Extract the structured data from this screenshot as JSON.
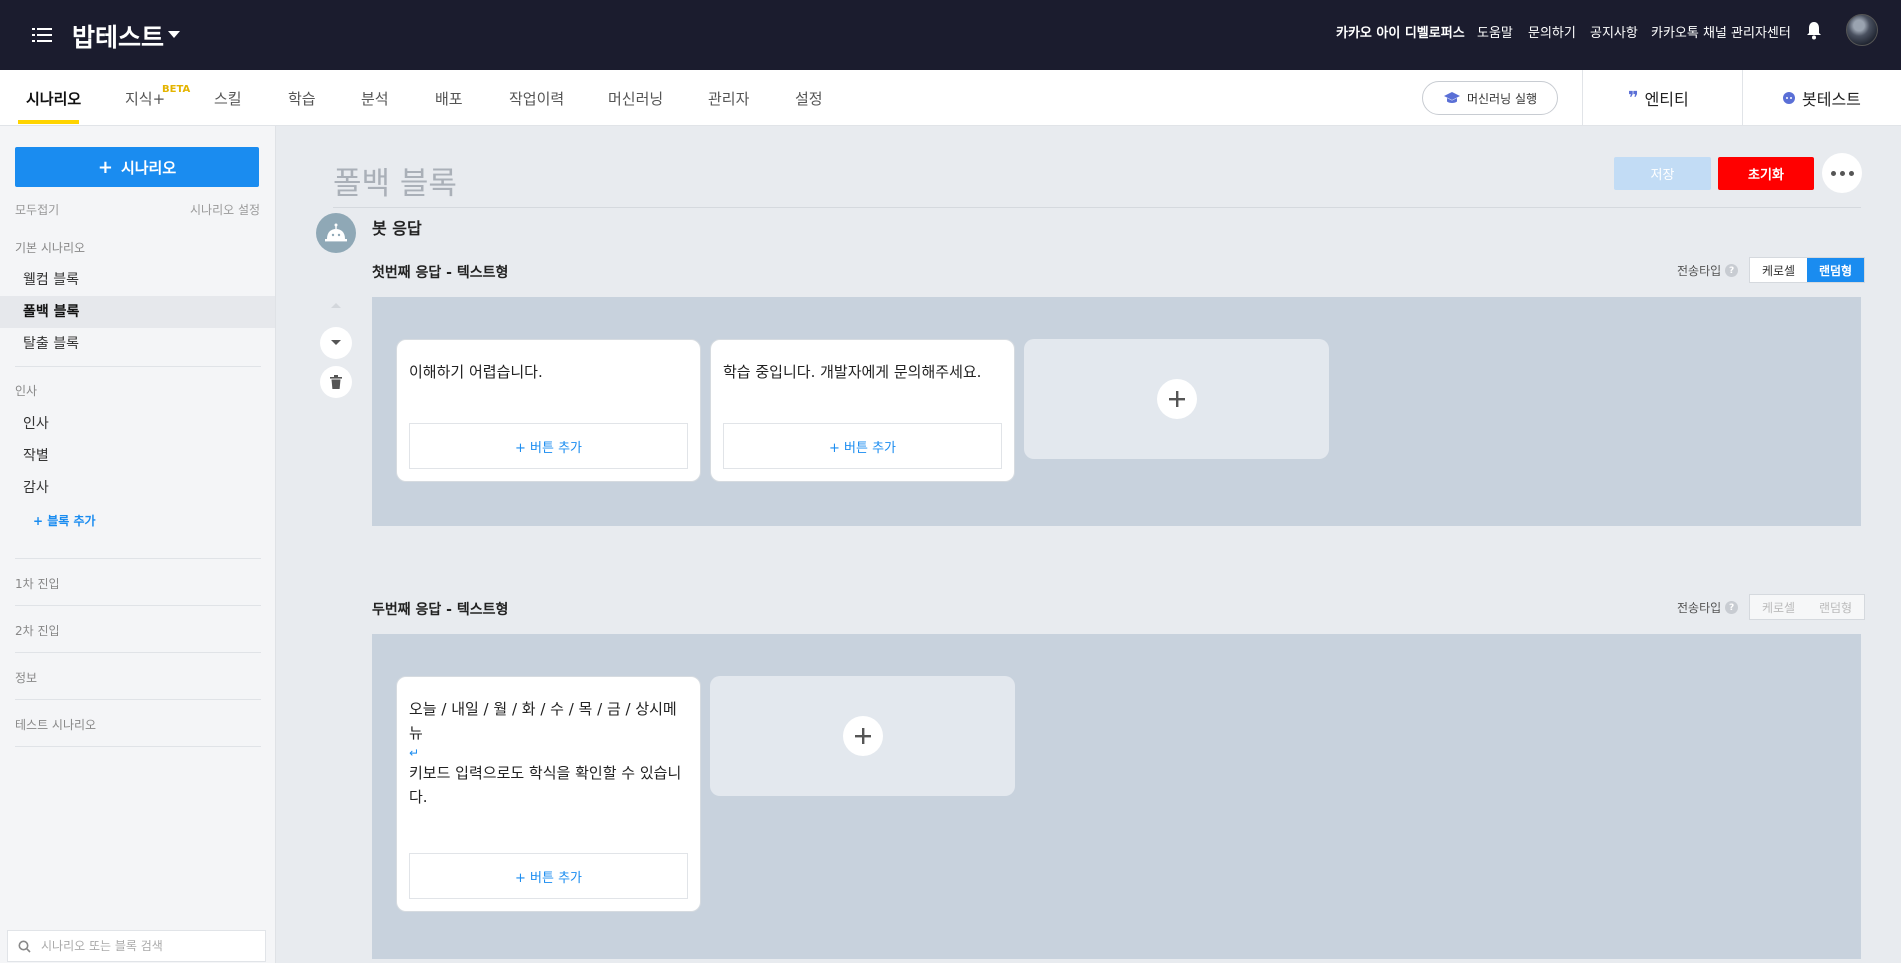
{
  "topbar": {
    "bot_name": "밥테스트",
    "nav": [
      "카카오 아이 디벨로퍼스",
      "도움말",
      "문의하기",
      "공지사항",
      "카카오톡 채널 관리자센터"
    ]
  },
  "tabs": {
    "items": [
      "시나리오",
      "지식+",
      "스킬",
      "학습",
      "분석",
      "배포",
      "작업이력",
      "머신러닝",
      "관리자",
      "설정"
    ],
    "beta_label": "BETA",
    "ml_run": "머신러닝 실행",
    "entity": "엔티티",
    "bot_test": "봇테스트"
  },
  "sidebar": {
    "add_scenario": "시나리오",
    "collapse_all": "모두접기",
    "scenario_settings": "시나리오 설정",
    "default_group": "기본 시나리오",
    "default_items": [
      "웰컴 블록",
      "폴백 블록",
      "탈출 블록"
    ],
    "greeting_group": "인사",
    "greeting_items": [
      "인사",
      "작별",
      "감사"
    ],
    "add_block": "+ 블록 추가",
    "groups": [
      "1차 진입",
      "2차 진입",
      "정보",
      "테스트 시나리오"
    ],
    "search_placeholder": "시나리오 또는 블록 검색"
  },
  "main": {
    "block_title": "폴백 블록",
    "save": "저장",
    "reset": "초기화",
    "bot_response": "봇 응답",
    "send_type_label": "전송타입",
    "carousel": "케로셀",
    "random": "랜덤형",
    "response1": {
      "label": "첫번째 응답 - 텍스트형",
      "cards": [
        "이해하기 어렵습니다.",
        "학습 중입니다. 개발자에게 문의해주세요."
      ],
      "add_button": "+ 버튼 추가"
    },
    "response2": {
      "label": "두번째 응답 - 텍스트형",
      "card_line1": "오늘 / 내일 / 월 / 화 / 수 / 목 / 금 / 상시메뉴",
      "card_break": "↵",
      "card_line2": "키보드 입력으로도 학식을 확인할 수 있습니다.",
      "add_button": "+ 버튼 추가"
    }
  },
  "colors": {
    "accent": "#1a8cf0",
    "reset": "#ff0000",
    "topbar": "#1b1c2e",
    "tab_underline": "#ffd400"
  }
}
